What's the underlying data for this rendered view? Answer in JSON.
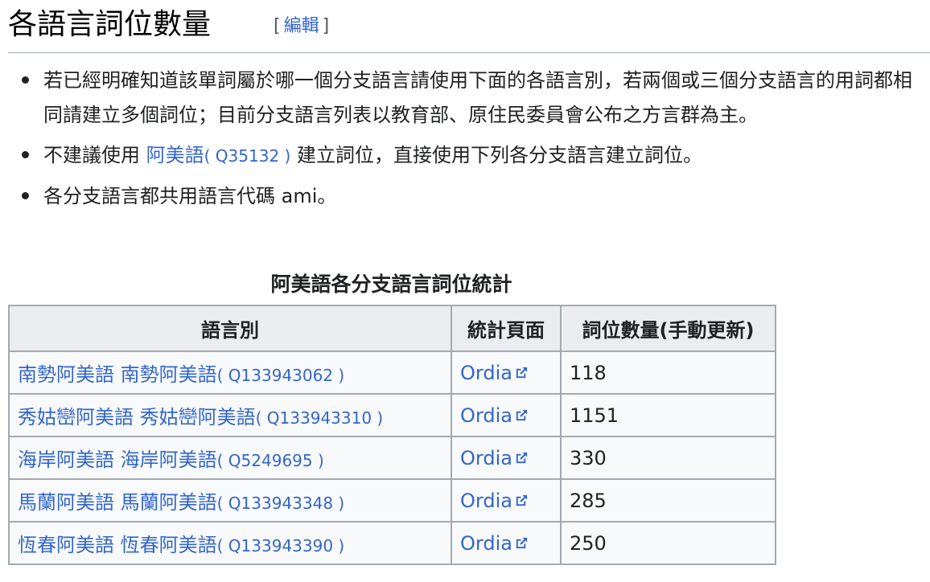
{
  "heading": {
    "title": "各語言詞位數量",
    "edit_open": "[",
    "edit_label": "編輯",
    "edit_close": "]"
  },
  "bullets": [
    {
      "text": "若已經明確知道該單詞屬於哪一個分支語言請使用下面的各語言別，若兩個或三個分支語言的用詞都相同請建立多個詞位；目前分支語言列表以教育部、原住民委員會公布之方言群為主。"
    },
    {
      "prefix": "不建議使用 ",
      "link": "阿美語",
      "qid": "( Q35132 )",
      "suffix": " 建立詞位，直接使用下列各分支語言建立詞位。"
    },
    {
      "text": "各分支語言都共用語言代碼 ami。"
    }
  ],
  "table": {
    "caption": "阿美語各分支語言詞位統計",
    "headers": [
      "語言別",
      "統計頁面",
      "詞位數量(手動更新)"
    ],
    "rows": [
      {
        "language": "南勢阿美語",
        "label": "南勢阿美語",
        "qid": "( Q133943062 )",
        "page": "Ordia",
        "count": "118"
      },
      {
        "language": "秀姑巒阿美語",
        "label": "秀姑巒阿美語",
        "qid": "( Q133943310 )",
        "page": "Ordia",
        "count": "1151"
      },
      {
        "language": "海岸阿美語",
        "label": "海岸阿美語",
        "qid": "( Q5249695 )",
        "page": "Ordia",
        "count": "330"
      },
      {
        "language": "馬蘭阿美語",
        "label": "馬蘭阿美語",
        "qid": "( Q133943348 )",
        "page": "Ordia",
        "count": "285"
      },
      {
        "language": "恆春阿美語",
        "label": "恆春阿美語",
        "qid": "( Q133943390 )",
        "page": "Ordia",
        "count": "250"
      }
    ]
  },
  "colors": {
    "link": "#3366cc",
    "border": "#a2a9b1",
    "header_bg": "#eaecf0",
    "table_bg": "#f8f9fa"
  },
  "icons": {
    "external_link": "external-link-icon",
    "bullet": "bullet-dot"
  }
}
